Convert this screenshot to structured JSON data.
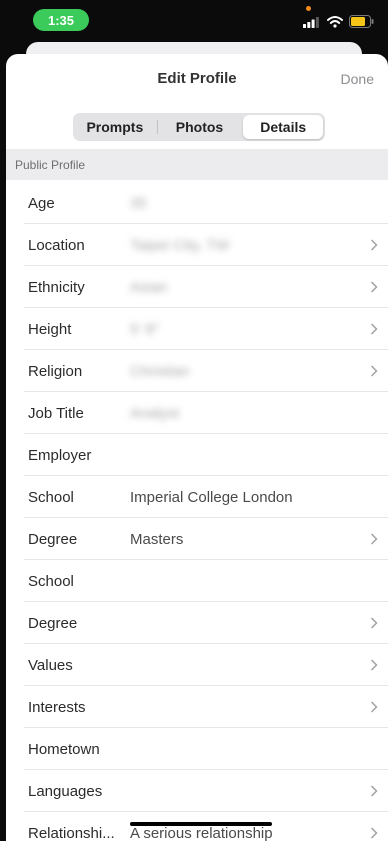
{
  "status_bar": {
    "time": "1:35",
    "accent_color": "#3acb5a"
  },
  "nav": {
    "title": "Edit Profile",
    "done_label": "Done"
  },
  "tabs": [
    {
      "label": "Prompts",
      "active": false
    },
    {
      "label": "Photos",
      "active": false
    },
    {
      "label": "Details",
      "active": true
    }
  ],
  "section": {
    "header": "Public Profile"
  },
  "rows": [
    {
      "label": "Age",
      "value": "35",
      "blurred": true,
      "chevron": false
    },
    {
      "label": "Location",
      "value": "Taipei City, TW",
      "blurred": true,
      "chevron": true
    },
    {
      "label": "Ethnicity",
      "value": "Asian",
      "blurred": true,
      "chevron": true
    },
    {
      "label": "Height",
      "value": "5' 8\"",
      "blurred": true,
      "chevron": true
    },
    {
      "label": "Religion",
      "value": "Christian",
      "blurred": true,
      "chevron": true
    },
    {
      "label": "Job Title",
      "value": "Analyst",
      "blurred": true,
      "chevron": false
    },
    {
      "label": "Employer",
      "value": "",
      "blurred": false,
      "chevron": false
    },
    {
      "label": "School",
      "value": "Imperial College London",
      "blurred": false,
      "chevron": false
    },
    {
      "label": "Degree",
      "value": "Masters",
      "blurred": false,
      "chevron": true
    },
    {
      "label": "School",
      "value": "",
      "blurred": false,
      "chevron": false
    },
    {
      "label": "Degree",
      "value": "",
      "blurred": false,
      "chevron": true
    },
    {
      "label": "Values",
      "value": "",
      "blurred": false,
      "chevron": true
    },
    {
      "label": "Interests",
      "value": "",
      "blurred": false,
      "chevron": true
    },
    {
      "label": "Hometown",
      "value": "",
      "blurred": false,
      "chevron": false
    },
    {
      "label": "Languages",
      "value": "",
      "blurred": false,
      "chevron": true
    },
    {
      "label": "Relationshi...",
      "value": "A serious relationship",
      "blurred": false,
      "chevron": true
    }
  ]
}
